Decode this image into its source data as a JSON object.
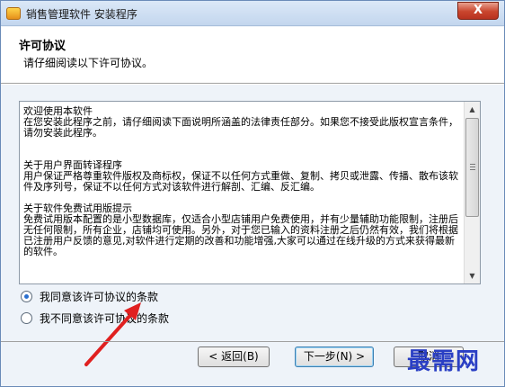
{
  "window": {
    "title": "销售管理软件 安装程序",
    "close_glyph": "X"
  },
  "header": {
    "title": "许可协议",
    "subtitle": "请仔细阅读以下许可协议。"
  },
  "license": {
    "text": "欢迎使用本软件\n在您安装此程序之前，请仔细阅读下面说明所涵盖的法律责任部分。如果您不接受此版权宣言条件，请勿安装此程序。\n\n\n关于用户界面转译程序\n用户保证严格尊重软件版权及商标权，保证不以任何方式重做、复制、拷贝或泄露、传播、散布该软件及序列号，保证不以任何方式对该软件进行解剖、汇编、反汇编。\n\n关于软件免费试用版提示\n免费试用版本配置的是小型数据库，仅适合小型店铺用户免费使用，并有少量辅助功能限制，注册后无任何限制，所有企业，店铺均可使用。另外，对于您已输入的资料注册之后仍然有效，我们将根据已注册用户反馈的意见,对软件进行定期的改善和功能增强,大家可以通过在线升级的方式来获得最新的软件。"
  },
  "scrollbar": {
    "up_glyph": "▲",
    "down_glyph": "▼"
  },
  "options": {
    "accept_label": "我同意该许可协议的条款",
    "decline_label": "我不同意该许可协议的条款",
    "selected": "accept"
  },
  "buttons": {
    "back_label": "< 返回(B)",
    "next_label": "下一步(N) >",
    "cancel_label": "取消"
  },
  "watermark": {
    "text": "最需网"
  },
  "colors": {
    "annotation_arrow": "#e02020",
    "watermark": "#2a3fc4"
  }
}
